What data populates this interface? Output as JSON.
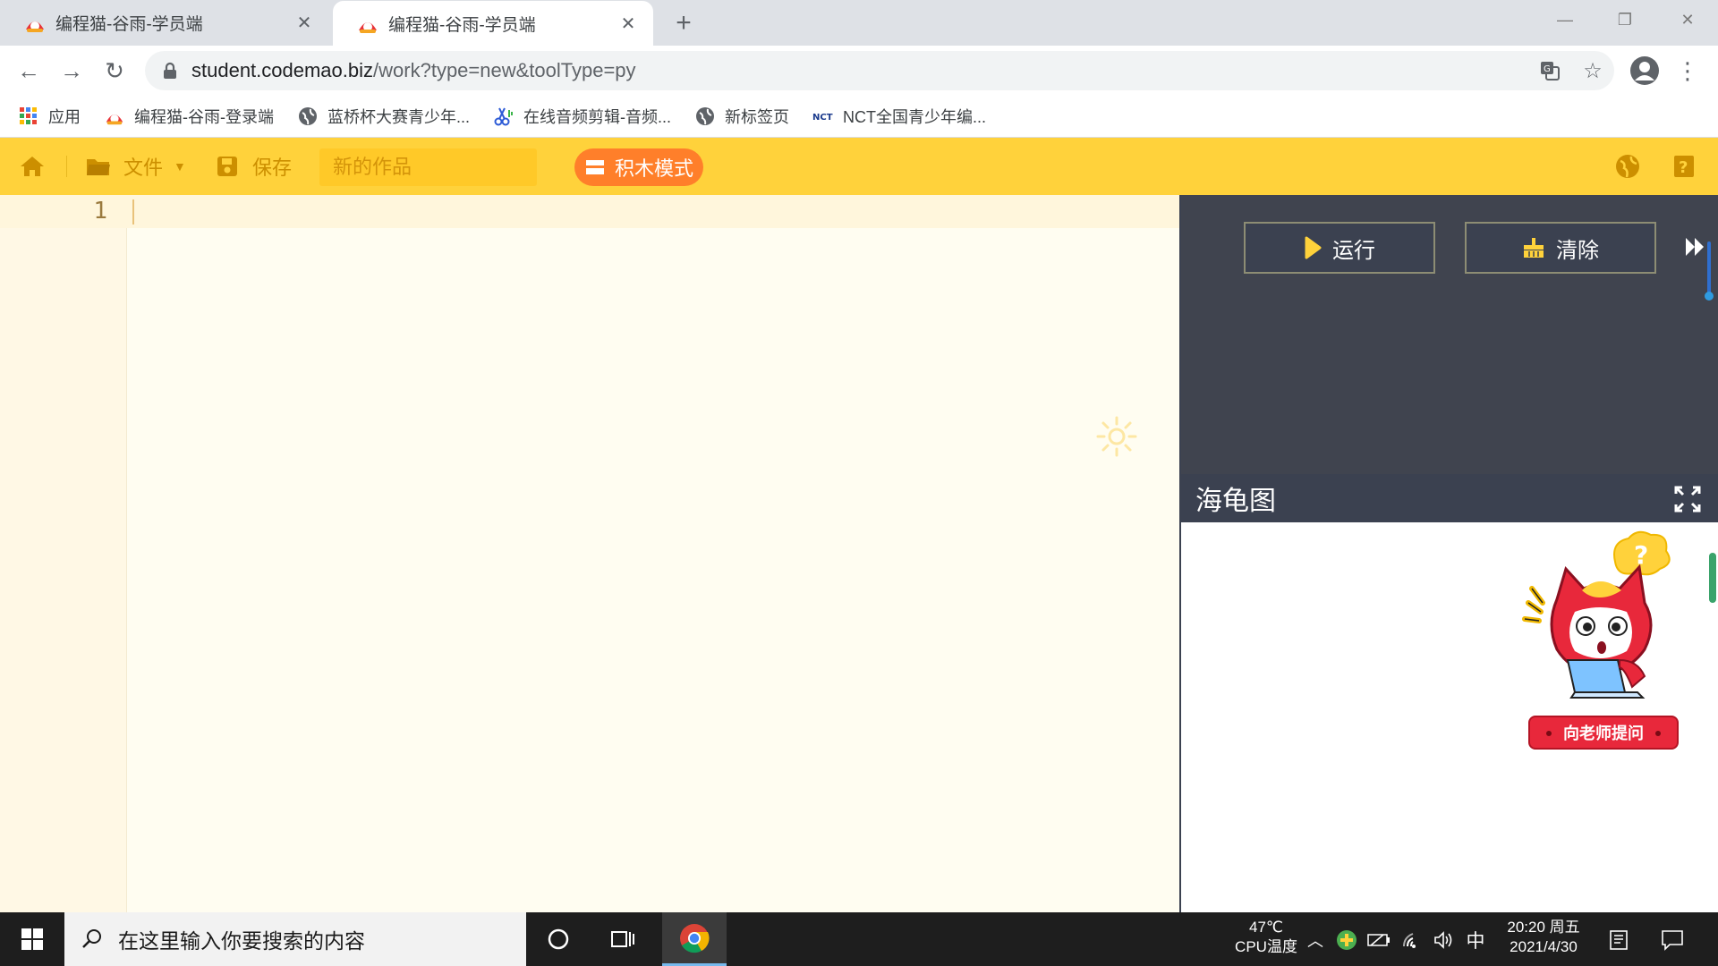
{
  "browser": {
    "tabs": [
      {
        "title": "编程猫-谷雨-学员端",
        "active": false
      },
      {
        "title": "编程猫-谷雨-学员端",
        "active": true
      }
    ],
    "new_tab_symbol": "+",
    "address": {
      "host": "student.codemao.biz",
      "path": "/work?type=new&toolType=py"
    },
    "bookmarks": [
      {
        "label": "应用",
        "icon": "apps-grid-icon"
      },
      {
        "label": "编程猫-谷雨-登录端",
        "icon": "codemao-icon"
      },
      {
        "label": "蓝桥杯大赛青少年...",
        "icon": "globe-icon"
      },
      {
        "label": "在线音频剪辑-音频...",
        "icon": "scissors-icon"
      },
      {
        "label": "新标签页",
        "icon": "globe-icon"
      },
      {
        "label": "NCT全国青少年编...",
        "icon": "nct-icon"
      }
    ]
  },
  "app": {
    "menu": {
      "file_label": "文件",
      "save_label": "保存",
      "title_placeholder": "新的作品",
      "block_mode_label": "积木模式"
    },
    "editor": {
      "line_numbers": [
        "1"
      ]
    },
    "console": {
      "run_label": "运行",
      "clear_label": "清除"
    },
    "turtle": {
      "title": "海龟图",
      "ask_teacher_label": "向老师提问",
      "mascot_bubble": "?"
    },
    "colors": {
      "header_yellow": "#ffd23b",
      "block_mode_orange": "#ff7f2a",
      "console_bg": "#40444f",
      "ask_button_red": "#e8283b"
    }
  },
  "taskbar": {
    "search_placeholder": "在这里输入你要搜索的内容",
    "cpu_temp": "47℃",
    "cpu_label": "CPU温度",
    "ime": "中",
    "time": "20:20 周五",
    "date": "2021/4/30"
  }
}
